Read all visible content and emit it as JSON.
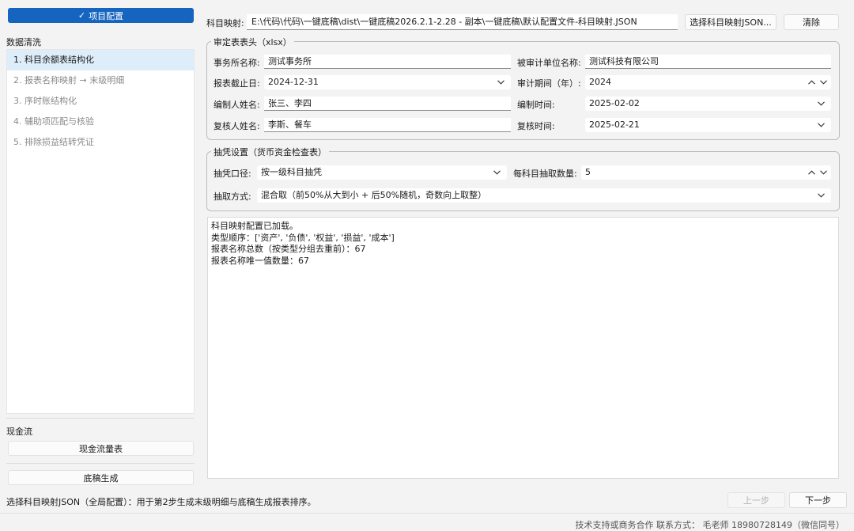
{
  "sidebar": {
    "project_button": "项目配置",
    "data_cleaning_label": "数据清洗",
    "steps": [
      "1. 科目余额表结构化",
      "2. 报表名称映射 → 末级明细",
      "3. 序时账结构化",
      "4. 辅助项匹配与核验",
      "5. 排除损益结转凭证"
    ],
    "active_step": 0,
    "cashflow_label": "现金流",
    "cashflow_button": "现金流量表",
    "draft_button": "底稿生成"
  },
  "mapping": {
    "label": "科目映射:",
    "path": "E:\\代码\\代码\\一键底稿\\dist\\一键底稿2026.2.1-2.28 - 副本\\一键底稿\\默认配置文件-科目映射.JSON",
    "select_button": "选择科目映射JSON...",
    "clear_button": "清除"
  },
  "audit_header": {
    "title": "审定表表头（xlsx）",
    "firm_label": "事务所名称:",
    "firm_value": "测试事务所",
    "entity_label": "被审计单位名称:",
    "entity_value": "测试科技有限公司",
    "report_date_label": "报表截止日:",
    "report_date_value": "2024-12-31",
    "period_label": "审计期间（年）:",
    "period_value": "2024",
    "preparer_label": "编制人姓名:",
    "preparer_value": "张三、李四",
    "prep_time_label": "编制时间:",
    "prep_time_value": "2025-02-02",
    "reviewer_label": "复核人姓名:",
    "reviewer_value": "李斯、餐车",
    "review_time_label": "复核时间:",
    "review_time_value": "2025-02-21"
  },
  "sampling": {
    "title": "抽凭设置（货币资金检查表）",
    "scope_label": "抽凭口径:",
    "scope_value": "按一级科目抽凭",
    "count_label": "每科目抽取数量:",
    "count_value": "5",
    "method_label": "抽取方式:",
    "method_value": "混合取（前50%从大到小 + 后50%随机，奇数向上取整）"
  },
  "log": [
    "科目映射配置已加载。",
    "类型顺序：['资产', '负债', '权益', '损益', '成本']",
    "报表名称总数（按类型分组去重前）：67",
    "报表名称唯一值数量：67"
  ],
  "status": {
    "hint": "选择科目映射JSON（全局配置）：用于第2步生成末级明细与底稿生成报表排序。",
    "prev_button": "上一步",
    "next_button": "下一步",
    "footer": "技术支持或商务合作 联系方式：  毛老师 18980728149（微信同号）"
  },
  "colors": {
    "accent": "#1565c0",
    "active_row": "#ddeefa"
  }
}
